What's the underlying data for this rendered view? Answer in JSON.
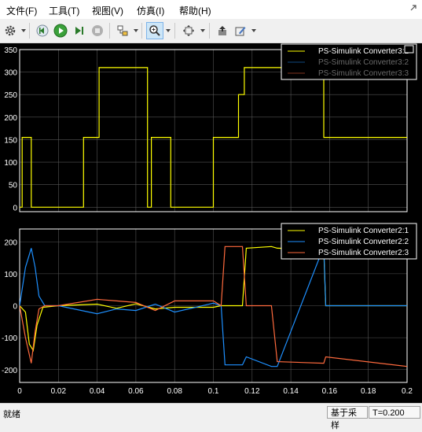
{
  "menu": [
    "文件(F)",
    "工具(T)",
    "视图(V)",
    "仿真(I)",
    "帮助(H)"
  ],
  "toolbar_icons": [
    "gear-icon",
    "rewind-icon",
    "run-icon",
    "step-forward-icon",
    "stop-icon",
    "highlight-icon",
    "zoom-icon",
    "fit-icon",
    "restore-icon",
    "style-icon"
  ],
  "colors": {
    "ch1": "#ffff00",
    "ch2": "#1e90ff",
    "ch3": "#ff6a3d",
    "axes": "#ffffff",
    "grid": "#555555",
    "background": "#000000"
  },
  "top_plot": {
    "ylim": [
      -10,
      350
    ],
    "yticks": [
      "0",
      "50",
      "100",
      "150",
      "200",
      "250",
      "300",
      "350"
    ],
    "legend": [
      "PS-Simulink Converter3:1",
      "PS-Simulink Converter3:2",
      "PS-Simulink Converter3:3"
    ],
    "legend_dim": [
      false,
      true,
      true
    ]
  },
  "bottom_plot": {
    "ylim": [
      -240,
      240
    ],
    "yticks": [
      "-200",
      "-100",
      "0",
      "100",
      "200"
    ],
    "xticks": [
      "0",
      "0.02",
      "0.04",
      "0.06",
      "0.08",
      "0.1",
      "0.12",
      "0.14",
      "0.16",
      "0.18",
      "0.2"
    ],
    "legend": [
      "PS-Simulink Converter2:1",
      "PS-Simulink Converter2:2",
      "PS-Simulink Converter2:3"
    ]
  },
  "xlim": [
    0,
    0.2
  ],
  "chart_data": [
    {
      "type": "line",
      "xlim": [
        0,
        0.2
      ],
      "ylim": [
        -10,
        350
      ],
      "series": [
        {
          "name": "PS-Simulink Converter3:1",
          "x": [
            0,
            0.0013,
            0.0013,
            0.006,
            0.006,
            0.03,
            0.03,
            0.033,
            0.033,
            0.041,
            0.041,
            0.058,
            0.058,
            0.066,
            0.066,
            0.068,
            0.068,
            0.078,
            0.078,
            0.1,
            0.1,
            0.103,
            0.103,
            0.113,
            0.113,
            0.116,
            0.116,
            0.157,
            0.157,
            0.2
          ],
          "y": [
            0,
            0,
            155,
            155,
            0,
            0,
            0,
            0,
            155,
            155,
            310,
            310,
            310,
            310,
            0,
            0,
            155,
            155,
            0,
            0,
            155,
            155,
            155,
            155,
            250,
            250,
            310,
            310,
            155,
            155
          ]
        },
        {
          "name": "PS-Simulink Converter3:2",
          "x": [],
          "y": []
        },
        {
          "name": "PS-Simulink Converter3:3",
          "x": [],
          "y": []
        }
      ]
    },
    {
      "type": "line",
      "xlim": [
        0,
        0.2
      ],
      "ylim": [
        -240,
        240
      ],
      "xticks": [
        0,
        0.02,
        0.04,
        0.06,
        0.08,
        0.1,
        0.12,
        0.14,
        0.16,
        0.18,
        0.2
      ],
      "series": [
        {
          "name": "PS-Simulink Converter2:1",
          "x": [
            0,
            0.003,
            0.005,
            0.007,
            0.009,
            0.012,
            0.02,
            0.04,
            0.05,
            0.06,
            0.07,
            0.08,
            0.1,
            0.104,
            0.106,
            0.115,
            0.117,
            0.13,
            0.133,
            0.157,
            0.158,
            0.2
          ],
          "y": [
            0,
            -20,
            -120,
            -140,
            -60,
            -5,
            0,
            5,
            -8,
            6,
            -10,
            -5,
            -5,
            0,
            0,
            0,
            180,
            185,
            180,
            175,
            0,
            0
          ]
        },
        {
          "name": "PS-Simulink Converter2:2",
          "x": [
            0,
            0.003,
            0.006,
            0.008,
            0.01,
            0.013,
            0.02,
            0.04,
            0.05,
            0.06,
            0.07,
            0.08,
            0.1,
            0.104,
            0.106,
            0.115,
            0.117,
            0.13,
            0.133,
            0.157,
            0.158,
            0.2
          ],
          "y": [
            0,
            120,
            180,
            120,
            30,
            0,
            0,
            -25,
            -10,
            -15,
            5,
            -20,
            8,
            0,
            -185,
            -185,
            -160,
            -190,
            -190,
            185,
            0,
            0
          ]
        },
        {
          "name": "PS-Simulink Converter2:3",
          "x": [
            0,
            0.003,
            0.006,
            0.008,
            0.01,
            0.013,
            0.02,
            0.04,
            0.05,
            0.06,
            0.07,
            0.08,
            0.1,
            0.104,
            0.106,
            0.115,
            0.117,
            0.13,
            0.133,
            0.157,
            0.158,
            0.2
          ],
          "y": [
            0,
            -100,
            -180,
            -80,
            -10,
            0,
            0,
            20,
            15,
            10,
            -15,
            15,
            15,
            0,
            185,
            185,
            0,
            0,
            -175,
            -180,
            -160,
            -190
          ]
        }
      ]
    }
  ],
  "status": {
    "text": "就绪",
    "mode": "基于采样",
    "time": "T=0.200"
  }
}
